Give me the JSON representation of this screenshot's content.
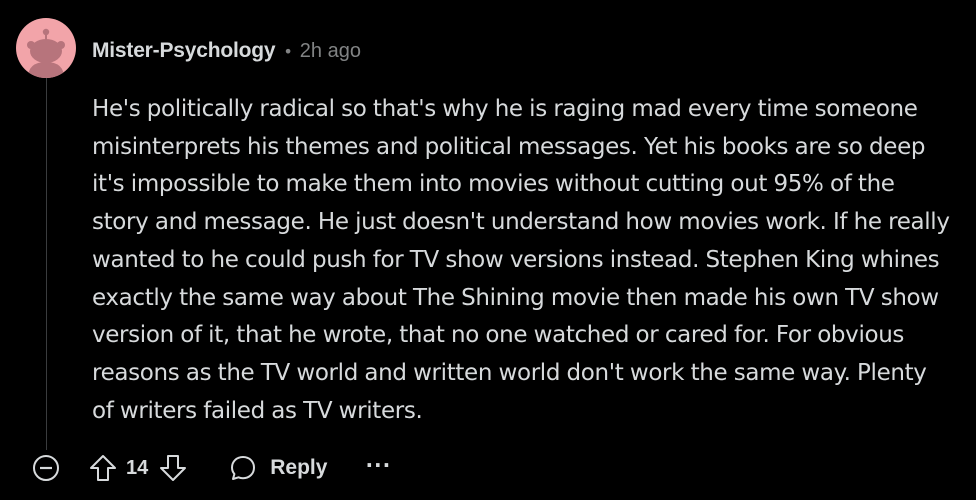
{
  "comment": {
    "author": "Mister-Psychology",
    "separator": "•",
    "time_ago": "2h ago",
    "body_lines": [
      "He's politically radical so that's why he is raging mad every time someone",
      "misinterprets his themes and political messages. Yet his books are so deep",
      "it's impossible to make them into movies without cutting out 95% of the",
      "story and message. He just doesn't understand how movies work. If he really",
      "wanted to he could push for TV show versions instead. Stephen King whines",
      "exactly the same way about The Shining movie then made his own TV show",
      "version of it, that he wrote, that no one watched or cared for. For obvious",
      "reasons as the TV world and written world don't work the same way. Plenty",
      "of writers failed as TV writers."
    ]
  },
  "actions": {
    "collapse_icon": "collapse-minus-icon",
    "upvote_icon": "upvote-arrow-icon",
    "score": "14",
    "downvote_icon": "downvote-arrow-icon",
    "reply_icon": "speech-bubble-icon",
    "reply_label": "Reply",
    "more_label": "···"
  },
  "colors": {
    "background": "#000000",
    "text": "#d7dadc",
    "muted": "#818384",
    "avatar_bg": "#f2a4a9",
    "avatar_figure": "#b7747c"
  }
}
